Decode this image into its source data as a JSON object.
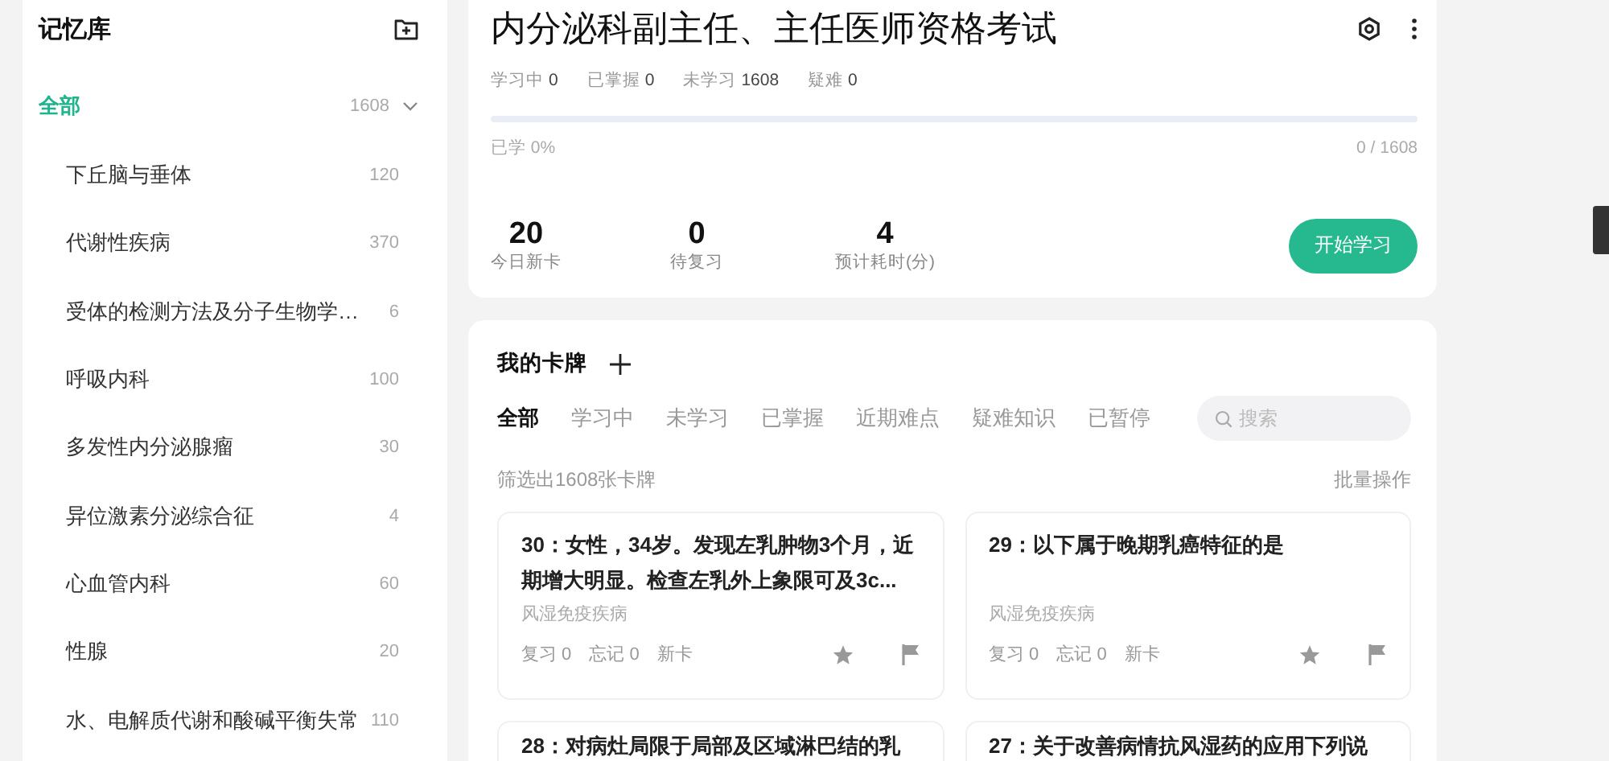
{
  "sidebar": {
    "title": "记忆库",
    "all": {
      "label": "全部",
      "count": "1608",
      "selected": true,
      "expanded": true
    },
    "items": [
      {
        "label": "下丘脑与垂体",
        "count": "120"
      },
      {
        "label": "代谢性疾病",
        "count": "370"
      },
      {
        "label": "受体的检测方法及分子生物学…",
        "count": "6"
      },
      {
        "label": "呼吸内科",
        "count": "100"
      },
      {
        "label": "多发性内分泌腺瘤",
        "count": "30"
      },
      {
        "label": "异位激素分泌综合征",
        "count": "4"
      },
      {
        "label": "心血管内科",
        "count": "60"
      },
      {
        "label": "性腺",
        "count": "20"
      },
      {
        "label": "水、电解质代谢和酸碱平衡失常",
        "count": "110"
      }
    ]
  },
  "deck": {
    "title": "内分泌科副主任、主任医师资格考试",
    "stats": [
      {
        "label": "学习中",
        "value": "0"
      },
      {
        "label": "已掌握",
        "value": "0"
      },
      {
        "label": "未学习",
        "value": "1608"
      },
      {
        "label": "疑难",
        "value": "0"
      }
    ],
    "progress": {
      "level": 0,
      "label": "已学 0%",
      "reading": "0 / 1608"
    },
    "metrics": [
      {
        "value": "20",
        "label": "今日新卡"
      },
      {
        "value": "0",
        "label": "待复习"
      },
      {
        "value": "4",
        "label": "预计耗时(分)"
      }
    ],
    "start_button": "开始学习"
  },
  "cards_panel": {
    "title": "我的卡牌",
    "tabs": [
      {
        "label": "全部",
        "selected": true
      },
      {
        "label": "学习中",
        "selected": false
      },
      {
        "label": "未学习",
        "selected": false
      },
      {
        "label": "已掌握",
        "selected": false
      },
      {
        "label": "近期难点",
        "selected": false
      },
      {
        "label": "疑难知识",
        "selected": false
      },
      {
        "label": "已暂停",
        "selected": false
      }
    ],
    "search": {
      "placeholder": "搜索"
    },
    "filter_summary": "筛选出1608张卡牌",
    "batch_action": "批量操作",
    "cards": [
      {
        "title": "30：女性，34岁。发现左乳肿物3个月，近期增大明显。检查左乳外上象限可及3c...",
        "category": "风湿免疫疾病",
        "review": "复习 0",
        "forget": "忘记 0",
        "status": "新卡"
      },
      {
        "title": "29：以下属于晚期乳癌特征的是",
        "category": "风湿免疫疾病",
        "review": "复习 0",
        "forget": "忘记 0",
        "status": "新卡"
      },
      {
        "title": "28：对病灶局限于局部及区域淋巴结的乳"
      },
      {
        "title": "27：关于改善病情抗风湿药的应用下列说"
      }
    ]
  }
}
